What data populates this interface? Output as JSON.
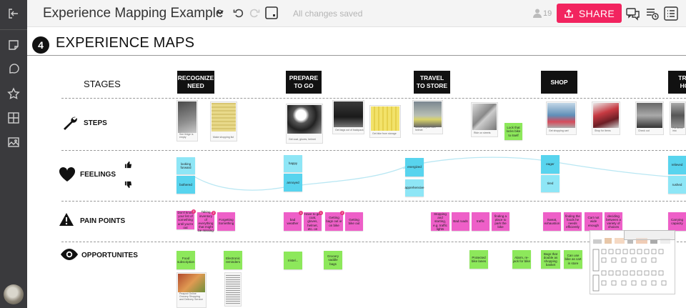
{
  "header": {
    "board_title": "Experience Mapping Example",
    "save_status": "All changes saved",
    "collaborator_count": "19",
    "share_label": "SHARE",
    "accent_color": "#f2245f"
  },
  "sidebar": {
    "items": [
      {
        "name": "exit-board-icon"
      },
      {
        "name": "sticky-note-icon"
      },
      {
        "name": "comment-shape-icon"
      },
      {
        "name": "star-icon"
      },
      {
        "name": "grid-icon"
      },
      {
        "name": "image-icon"
      }
    ]
  },
  "toolbar_right": [
    {
      "name": "chat-icon"
    },
    {
      "name": "activity-icon"
    },
    {
      "name": "list-icon"
    }
  ],
  "section": {
    "number": "4",
    "title": "EXPERIENCE MAPS"
  },
  "rows": {
    "stages": "STAGES",
    "steps": "STEPS",
    "feelings": "FEELINGS",
    "pain_points": "PAIN POINTS",
    "opportunities": "OPPORTUNITES"
  },
  "stages": [
    "RECOGNIZE NEED",
    "PREPARE TO GO",
    "TRAVEL TO STORE",
    "SHOP",
    "TRA HO"
  ],
  "steps_notes": {
    "lock_bike": "Lock that locks bike to itself"
  },
  "photo_captions": [
    "See fridge is empty",
    "Make shopping list",
    "Get coat, gloves, helmet",
    "Get bags out of backpack",
    "Get bike from storage",
    "Mount bicycle with helmet",
    "Ride on streets",
    "Get shopping cart",
    "Shop for items",
    "Check out",
    "Put items into"
  ],
  "feelings": {
    "thumbs_up": "thumbs-up-icon",
    "thumbs_down": "thumbs-down-icon",
    "notes": [
      "looking forward",
      "bothered",
      "happy",
      "annoyed",
      "energized",
      "apprehensive",
      "eager",
      "tired",
      "relieved",
      "rushed"
    ]
  },
  "pain_points": [
    {
      "text": "Don't know your list of something until you're out",
      "badge": "2"
    },
    {
      "text": "Taking inventory of everything that might be missing",
      "badge": "2"
    },
    {
      "text": "Forgetting Something",
      "badge": ""
    },
    {
      "text": "bad weather",
      "badge": "1"
    },
    {
      "text": "Have to get coat, gloves, helmet, etc. on",
      "badge": "1"
    },
    {
      "text": "Getting bags out or on bike",
      "badge": "2"
    },
    {
      "text": "Getting bike out",
      "badge": ""
    },
    {
      "text": "Stopping and starting, e.g. traffic lights",
      "badge": ""
    },
    {
      "text": "Bad roads",
      "badge": ""
    },
    {
      "text": "traffic",
      "badge": ""
    },
    {
      "text": "finding a place to park the bike",
      "badge": ""
    },
    {
      "text": "Sweat, exhaustion",
      "badge": ""
    },
    {
      "text": "finding the foods he needs efficiently",
      "badge": ""
    },
    {
      "text": "Cart not wide enough",
      "badge": ""
    },
    {
      "text": "deciding between a variety of choices",
      "badge": ""
    },
    {
      "text": "Carrying capacity",
      "badge": ""
    }
  ],
  "opportunities": [
    "Food subscription",
    "Electronic reminders",
    "rristel...",
    "Grocery saddle bags",
    "Protected bike lanes",
    "Alarm, re-jack for bike",
    "Bags that double as shopping basket",
    "Can use bike as cart in store"
  ],
  "doc_caption": "Peapod Online Grocery Shopping and Delivery Service"
}
